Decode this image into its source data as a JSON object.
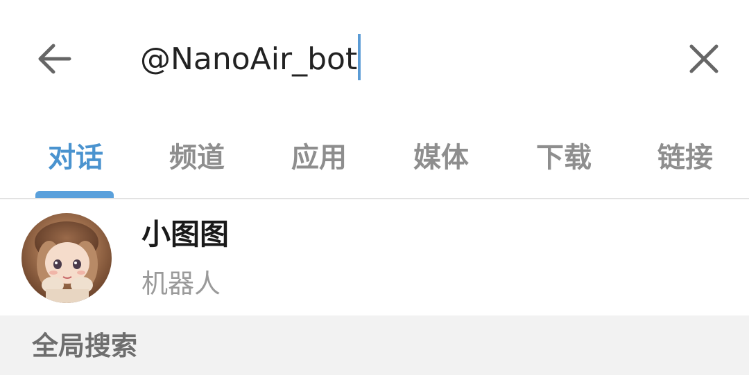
{
  "search": {
    "query": "@NanoAir_bot",
    "back_icon": "arrow-left-icon",
    "clear_icon": "close-icon"
  },
  "tabs": [
    {
      "label": "对话",
      "active": true
    },
    {
      "label": "频道",
      "active": false
    },
    {
      "label": "应用",
      "active": false
    },
    {
      "label": "媒体",
      "active": false
    },
    {
      "label": "下载",
      "active": false
    },
    {
      "label": "链接",
      "active": false
    }
  ],
  "results": [
    {
      "name": "小图图",
      "subtitle": "机器人",
      "avatar": "avatar-image"
    }
  ],
  "global_section": {
    "label": "全局搜索"
  },
  "colors": {
    "accent": "#4a93cf",
    "indicator": "#5aa0db",
    "tab_inactive": "#8e8e8e",
    "section_bg": "#f2f2f2"
  }
}
